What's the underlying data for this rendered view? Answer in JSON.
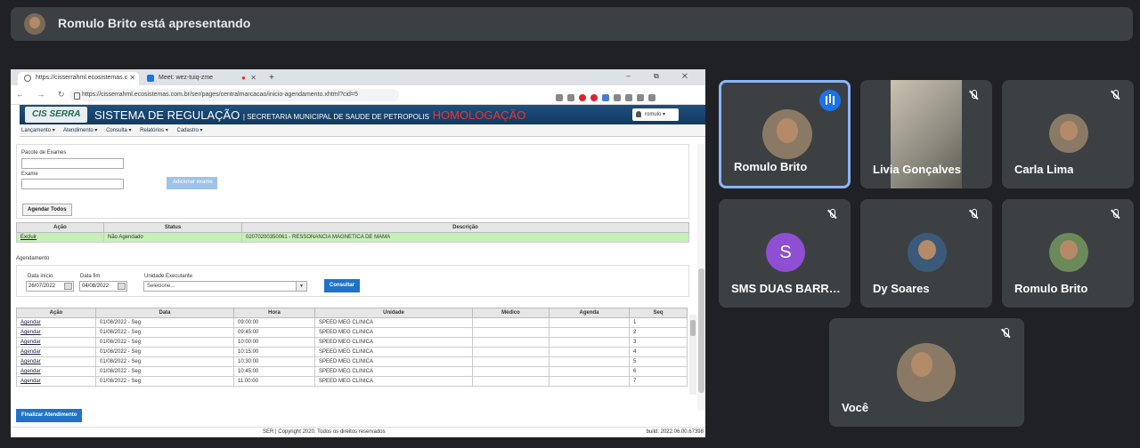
{
  "meet": {
    "presenting_label": "Romulo Brito está apresentando"
  },
  "browser": {
    "tab1_title": "https://cisserrahml.ecosistemas.c",
    "tab2_title": "Meet: wez-tuiq-zme",
    "url": "https://cisserrahml.ecosistemas.com.br/ser/pages/centralmarcacao/inicio-agendamento.xhtml?cid=5",
    "new_tab": "+",
    "window_controls": "– ⧉ ✕",
    "nav_icons": "← → ↻"
  },
  "app": {
    "logo": "CIS SERRA",
    "title": "SISTEMA DE REGULAÇÃO",
    "subtitle": "| SECRETARIA MUNICIPAL DE SAUDE DE PETROPOLIS",
    "environment": "HOMOLOGAÇÃO",
    "user": "romulo ▾",
    "menu": [
      "Lançamento ▾",
      "Atendimento ▾",
      "Consulta ▾",
      "Relatórios ▾",
      "Cadastro ▾"
    ]
  },
  "exams": {
    "pacote_label": "Pacote de Exames",
    "exame_label": "Exame",
    "add_button": "Adicionar exame",
    "agendar_todos": "Agendar Todos",
    "table_headers": [
      "Ação",
      "Status",
      "Descrição"
    ],
    "rows": [
      {
        "acao": "Excluir",
        "status": "Não Agendado",
        "descricao": "02070200350061 - RESSONANCIA MAGNETICA DE MAMA"
      }
    ]
  },
  "agendamento": {
    "section_label": "Agendamento",
    "data_inicio_label": "Data início",
    "data_inicio": "26/07/2022",
    "data_fim_label": "Data fim",
    "data_fim": "04/08/2022",
    "unidade_label": "Unidade Executante",
    "unidade_placeholder": "Selecione...",
    "consultar": "Consultar",
    "headers": [
      "Ação",
      "Data",
      "Hora",
      "Unidade",
      "Médico",
      "Agenda",
      "Seq"
    ],
    "rows": [
      {
        "acao": "Agendar",
        "data": "01/08/2022 - Seg",
        "hora": "09:00:00",
        "unidade": "SPEED MEG CLINICA",
        "medico": "",
        "agenda": "",
        "seq": "1"
      },
      {
        "acao": "Agendar",
        "data": "01/08/2022 - Seg",
        "hora": "09:45:00",
        "unidade": "SPEED MEG CLINICA",
        "medico": "",
        "agenda": "",
        "seq": "2"
      },
      {
        "acao": "Agendar",
        "data": "01/08/2022 - Seg",
        "hora": "10:00:00",
        "unidade": "SPEED MEG CLINICA",
        "medico": "",
        "agenda": "",
        "seq": "3"
      },
      {
        "acao": "Agendar",
        "data": "01/08/2022 - Seg",
        "hora": "10:15:00",
        "unidade": "SPEED MEG CLINICA",
        "medico": "",
        "agenda": "",
        "seq": "4"
      },
      {
        "acao": "Agendar",
        "data": "01/08/2022 - Seg",
        "hora": "10:30:00",
        "unidade": "SPEED MEG CLINICA",
        "medico": "",
        "agenda": "",
        "seq": "5"
      },
      {
        "acao": "Agendar",
        "data": "01/08/2022 - Seg",
        "hora": "10:45:00",
        "unidade": "SPEED MEG CLINICA",
        "medico": "",
        "agenda": "",
        "seq": "6"
      },
      {
        "acao": "Agendar",
        "data": "01/08/2022 - Seg",
        "hora": "11:00:00",
        "unidade": "SPEED MEG CLINICA",
        "medico": "",
        "agenda": "",
        "seq": "7"
      }
    ],
    "finalizar": "Finalizar Atendimento"
  },
  "footer": {
    "copyright": "SER | Copyright 2020. Todos os direitos reservados",
    "build": "build: 2022.06.00.67398"
  },
  "participants": [
    {
      "name": "Romulo Brito",
      "speaking": true
    },
    {
      "name": "Livia Gonçalves",
      "speaking": false
    },
    {
      "name": "Carla Lima",
      "speaking": false
    },
    {
      "name": "SMS DUAS BARRAS",
      "speaking": false,
      "initial": "S"
    },
    {
      "name": "Dy Soares",
      "speaking": false
    },
    {
      "name": "Romulo Brito",
      "speaking": false
    },
    {
      "name": "Você",
      "speaking": false
    }
  ],
  "colors": {
    "meet_bg": "#202124",
    "tile_bg": "#3c4043",
    "speaking_border": "#8ab4f8",
    "app_header": "#1d4f7e",
    "homolog": "#ee3333",
    "row_green": "#c7f0b8",
    "button_blue": "#1e73c8"
  }
}
